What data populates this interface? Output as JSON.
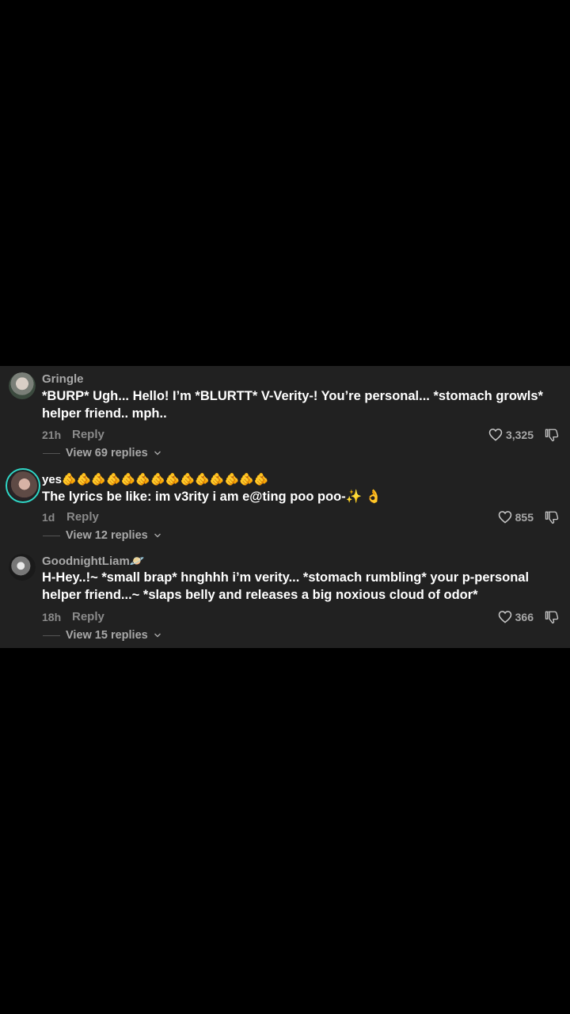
{
  "colors": {
    "background": "#000000",
    "panel": "#212121",
    "text_primary": "#ffffff",
    "text_secondary": "#a8a8a8",
    "story_ring": "#2fd6c6"
  },
  "comments": [
    {
      "username": "Gringle",
      "text": "*BURP* Ugh... Hello! I’m *BLURTT* V-Verity-! You’re personal... *stomach growls* helper friend.. mph..",
      "time": "21h",
      "reply_label": "Reply",
      "likes": "3,325",
      "view_replies": "View 69 replies",
      "avatar_icon": "profile-photo"
    },
    {
      "username": "yes🫵🫵🫵🫵🫵🫵🫵🫵🫵🫵🫵🫵🫵🫵",
      "text": "The lyrics be like: im v3rity i am e@ting poo poo-✨ 👌",
      "time": "1d",
      "reply_label": "Reply",
      "likes": "855",
      "view_replies": "View 12 replies",
      "avatar_icon": "profile-photo-with-story-ring"
    },
    {
      "username": "GoodnightLiam🪐",
      "text": "H-Hey..!~ *small brap* hnghhh i’m verity... *stomach rumbling* your p-personal helper friend...~ *slaps belly and releases a big noxious cloud of odor*",
      "time": "18h",
      "reply_label": "Reply",
      "likes": "366",
      "view_replies": "View 15 replies",
      "avatar_icon": "profile-photo"
    }
  ],
  "icons": {
    "like": "heart-outline-icon",
    "dislike": "thumbs-down-outline-icon",
    "expand": "chevron-down-icon"
  }
}
